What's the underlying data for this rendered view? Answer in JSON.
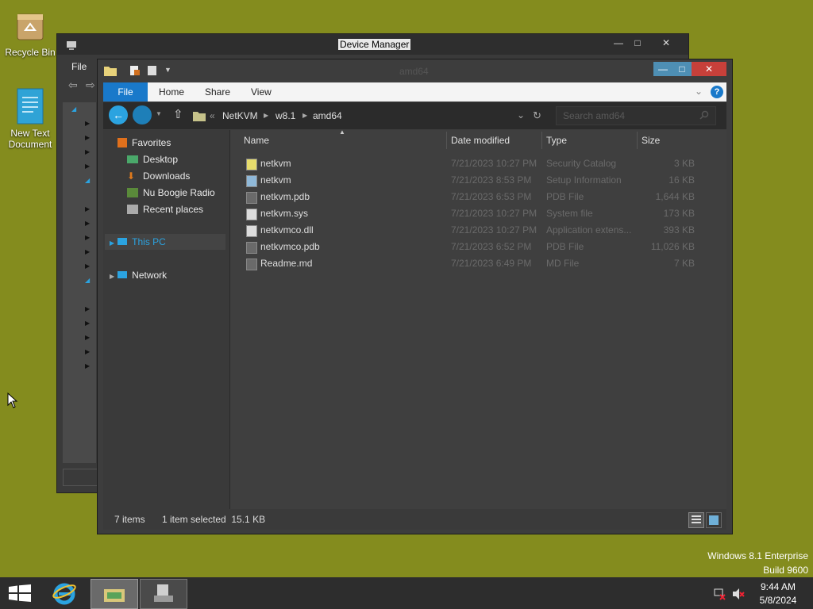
{
  "desktop": {
    "icons": [
      {
        "label": "Recycle Bin"
      },
      {
        "label_line1": "New Text",
        "label_line2": "Document"
      }
    ],
    "watermark": {
      "line1": "Windows 8.1 Enterprise",
      "line2": "Build 9600"
    }
  },
  "device_manager": {
    "title": "Device Manager",
    "menu_file": "File"
  },
  "explorer": {
    "title": "amd64",
    "ribbon_tabs": [
      "File",
      "Home",
      "Share",
      "View"
    ],
    "breadcrumb": [
      "NetKVM",
      "w8.1",
      "amd64"
    ],
    "breadcrumb_prefix": "«",
    "search_placeholder": "Search amd64",
    "nav": {
      "favorites": "Favorites",
      "items": [
        "Desktop",
        "Downloads",
        "Nu Boogie Radio",
        "Recent places"
      ],
      "this_pc": "This PC",
      "network": "Network"
    },
    "columns": [
      "Name",
      "Date modified",
      "Type",
      "Size"
    ],
    "files": [
      {
        "name": "netkvm",
        "date": "7/21/2023 10:27 PM",
        "type": "Security Catalog",
        "size": "3 KB",
        "icon": "catalog-icon"
      },
      {
        "name": "netkvm",
        "date": "7/21/2023 8:53 PM",
        "type": "Setup Information",
        "size": "16 KB",
        "icon": "setup-info-icon"
      },
      {
        "name": "netkvm.pdb",
        "date": "7/21/2023 6:53 PM",
        "type": "PDB File",
        "size": "1,644 KB",
        "icon": "file-icon"
      },
      {
        "name": "netkvm.sys",
        "date": "7/21/2023 10:27 PM",
        "type": "System file",
        "size": "173 KB",
        "icon": "system-file-icon"
      },
      {
        "name": "netkvmco.dll",
        "date": "7/21/2023 10:27 PM",
        "type": "Application extens...",
        "size": "393 KB",
        "icon": "dll-icon"
      },
      {
        "name": "netkvmco.pdb",
        "date": "7/21/2023 6:52 PM",
        "type": "PDB File",
        "size": "11,026 KB",
        "icon": "file-icon"
      },
      {
        "name": "Readme.md",
        "date": "7/21/2023 6:49 PM",
        "type": "MD File",
        "size": "7 KB",
        "icon": "file-icon"
      }
    ],
    "status": {
      "count": "7 items",
      "selection": "1 item selected  15.1 KB"
    }
  },
  "taskbar": {
    "time": "9:44 AM",
    "date": "5/8/2024"
  },
  "colors": {
    "desktop": "#848c1e",
    "accent": "#1979ca",
    "window_dark": "#3d3d3d"
  }
}
